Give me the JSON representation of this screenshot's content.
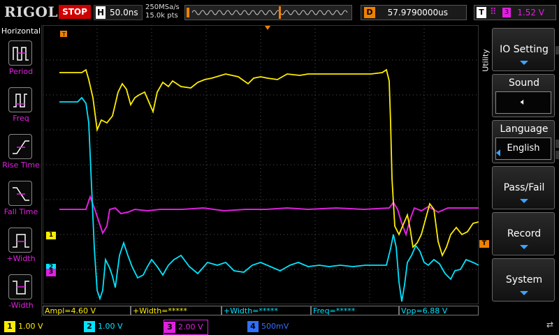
{
  "header": {
    "brand": "RIGOL",
    "run_state": "STOP",
    "horizontal_label": "H",
    "timebase": "50.0ns",
    "sample_rate": "250MSa/s",
    "memory_depth": "15.0k pts",
    "delay_label": "D",
    "delay": "57.9790000us",
    "trigger_label": "T",
    "trigger_channel": "3",
    "trigger_level": "1.52 V"
  },
  "left_menu": {
    "title": "Horizontal",
    "items": [
      {
        "label": "Period",
        "icon": "period-icon"
      },
      {
        "label": "Freq",
        "icon": "frequency-icon"
      },
      {
        "label": "Rise Time",
        "icon": "rise-time-icon"
      },
      {
        "label": "Fall Time",
        "icon": "fall-time-icon"
      },
      {
        "label": "+Width",
        "icon": "positive-width-icon"
      },
      {
        "label": "-Width",
        "icon": "negative-width-icon"
      }
    ]
  },
  "right_menu": {
    "tab": "Utility",
    "items": [
      {
        "label": "IO Setting"
      },
      {
        "label": "Sound"
      },
      {
        "label": "Language",
        "value": "English"
      },
      {
        "label": "Pass/Fail"
      },
      {
        "label": "Record"
      },
      {
        "label": "System"
      }
    ]
  },
  "measurements": [
    {
      "text": "Ampl=4.60 V",
      "channel": 1
    },
    {
      "text": "+Width=*****",
      "channel": 1
    },
    {
      "text": "+Width=*****",
      "channel": 2
    },
    {
      "text": "Freq=*****",
      "channel": 2
    },
    {
      "text": "Vpp=6.88 V",
      "channel": 2
    }
  ],
  "channels": [
    {
      "num": "1",
      "scale": "1.00 V",
      "color": "#ffee00"
    },
    {
      "num": "2",
      "scale": "1.00 V",
      "color": "#00e5ff"
    },
    {
      "num": "3",
      "scale": "2.00 V",
      "color": "#e020e0"
    },
    {
      "num": "4",
      "scale": "500mV",
      "color": "#3070ff"
    }
  ],
  "markers": {
    "ch1": "1",
    "ch2": "2",
    "ch3": "3",
    "trigger": "T"
  },
  "colors": {
    "ch1": "#ffee00",
    "ch2": "#00e5ff",
    "ch3": "#e020e0",
    "trigger": "#f08000",
    "stop": "#d10000"
  }
}
